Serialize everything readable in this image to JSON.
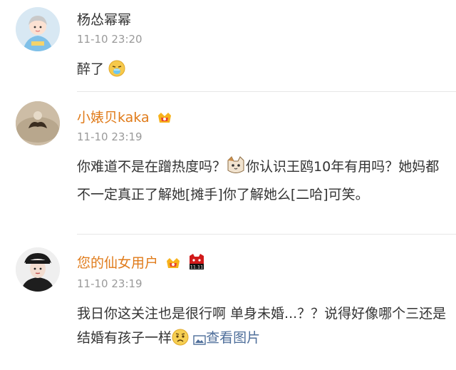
{
  "comments": [
    {
      "name": "杨怂幂幂",
      "time": "11-10 23:20",
      "text": "醉了"
    },
    {
      "name": "小婊贝kaka",
      "time": "11-10 23:19",
      "text_1": "你难道不是在蹭热度吗？",
      "text_2": "你认识王鸥10年有用吗？她妈都不一定真正了解她[摊手]你了解她么[二哈]可笑。"
    },
    {
      "name": "您的仙女用户",
      "time": "11-10 23:19",
      "text_1": "我日你这关注也是很行啊 单身未婚...？？说得好像哪个三还是结婚有孩子一样",
      "link": "查看图片"
    }
  ],
  "badges": {
    "double11": "11.11"
  },
  "colors": {
    "name_default": "#333333",
    "name_vip": "#e07b1a",
    "time": "#9a9a9a",
    "link": "#4e6e9a",
    "divider": "#e6e6e6"
  },
  "icons": [
    "drunk-face-emoji",
    "vip-crown-badge",
    "cat-face-emoji",
    "double11-cat-badge",
    "worried-face-emoji",
    "image-icon"
  ]
}
